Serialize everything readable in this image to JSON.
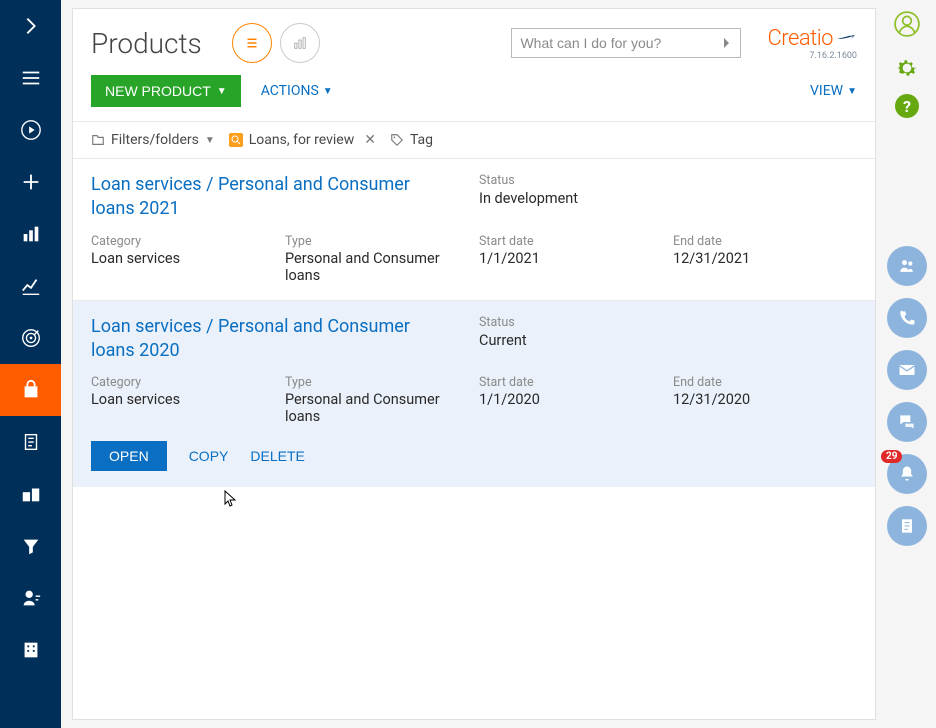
{
  "header": {
    "page_title": "Products",
    "search_placeholder": "What can I do for you?",
    "logo_text": "Creatio",
    "version": "7.16.2.1600"
  },
  "actions": {
    "new_button": "NEW PRODUCT",
    "actions_link": "ACTIONS",
    "view_link": "VIEW"
  },
  "filter": {
    "filters_folders": "Filters/folders",
    "folder_name": "Loans, for review",
    "tag": "Tag"
  },
  "labels": {
    "status": "Status",
    "category": "Category",
    "type": "Type",
    "start_date": "Start date",
    "end_date": "End date"
  },
  "rows": [
    {
      "title": "Loan services / Personal and Consumer loans 2021",
      "status": "In development",
      "category": "Loan services",
      "type": "Personal and Consumer loans",
      "start_date": "1/1/2021",
      "end_date": "12/31/2021"
    },
    {
      "title": "Loan services / Personal and Consumer loans 2020",
      "status": "Current",
      "category": "Loan services",
      "type": "Personal and Consumer loans",
      "start_date": "1/1/2020",
      "end_date": "12/31/2020"
    }
  ],
  "row_actions": {
    "open": "OPEN",
    "copy": "COPY",
    "delete": "DELETE"
  },
  "side_panel": {
    "notification_count": "29"
  }
}
